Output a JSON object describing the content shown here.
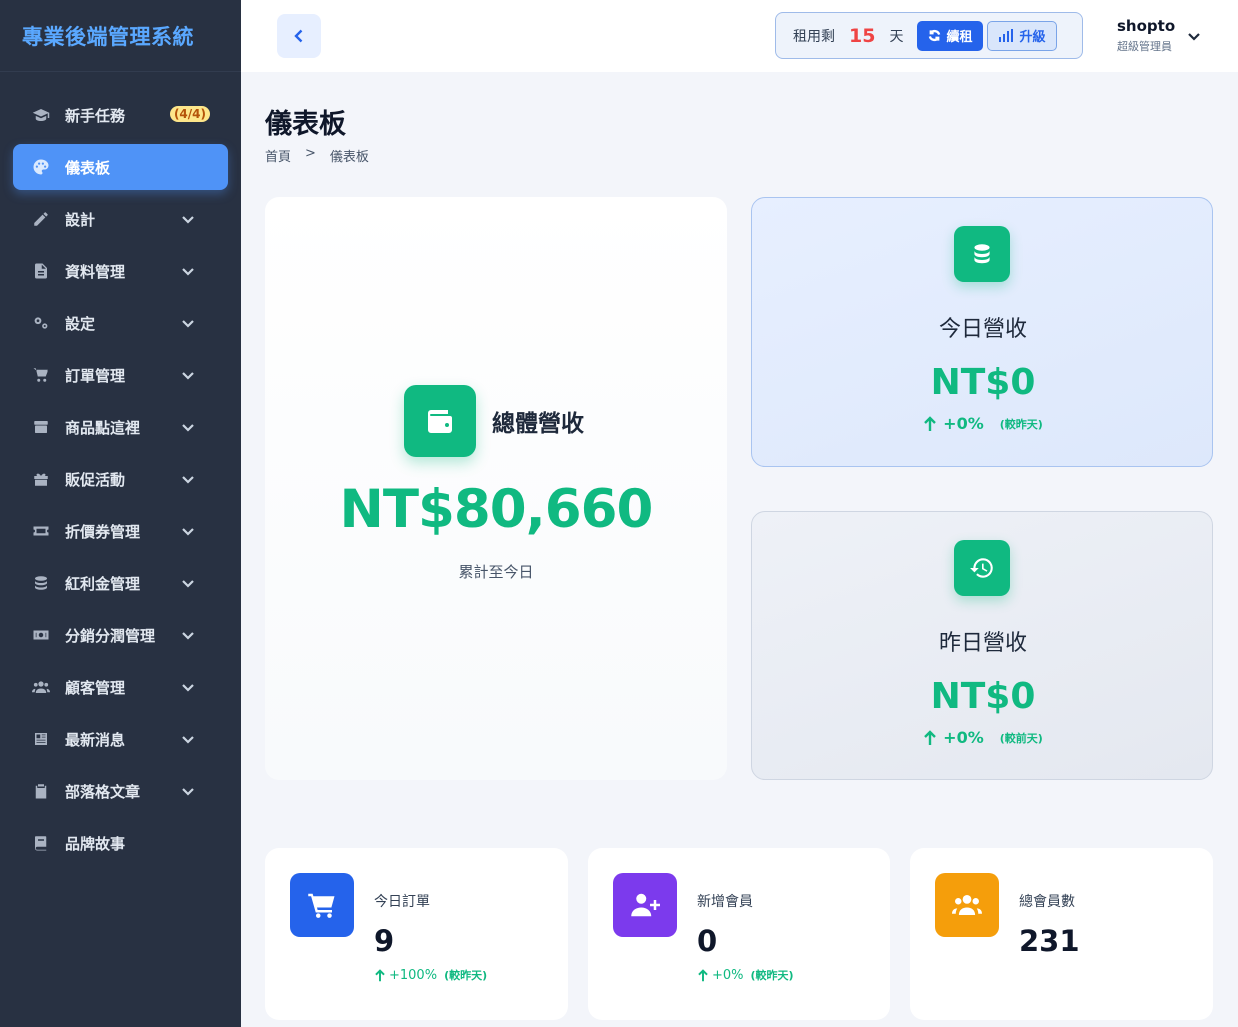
{
  "sidebar": {
    "brand": "專業後端管理系統",
    "items": [
      {
        "label": "新手任務",
        "badge": "(4/4)",
        "icon": "graduation-cap-icon"
      },
      {
        "label": "儀表板",
        "icon": "palette-icon",
        "active": true
      },
      {
        "label": "設計",
        "icon": "pencil-icon"
      },
      {
        "label": "資料管理",
        "icon": "file-icon"
      },
      {
        "label": "設定",
        "icon": "gears-icon"
      },
      {
        "label": "訂單管理",
        "icon": "cart-icon"
      },
      {
        "label": "商品點這裡",
        "icon": "box-icon"
      },
      {
        "label": "販促活動",
        "icon": "gift-icon"
      },
      {
        "label": "折價券管理",
        "icon": "ticket-icon"
      },
      {
        "label": "紅利金管理",
        "icon": "coins-icon"
      },
      {
        "label": "分銷分潤管理",
        "icon": "money-icon"
      },
      {
        "label": "顧客管理",
        "icon": "users-icon"
      },
      {
        "label": "最新消息",
        "icon": "newspaper-icon"
      },
      {
        "label": "部落格文章",
        "icon": "clipboard-icon"
      },
      {
        "label": "品牌故事",
        "icon": "book-icon"
      }
    ]
  },
  "topbar": {
    "rent_label": "租用剩",
    "rent_days": "15",
    "rent_unit": "天",
    "renew_label": "續租",
    "upgrade_label": "升級",
    "user_name": "shopto",
    "user_role": "超級管理員"
  },
  "page": {
    "title": "儀表板",
    "breadcrumb": [
      "首頁",
      ">",
      "儀表板"
    ]
  },
  "revenue": {
    "total_label": "總體營收",
    "total_value": "NT$80,660",
    "total_sub": "累計至今日",
    "today_label": "今日營收",
    "today_value": "NT$0",
    "today_change": "+0%",
    "today_compare": "(較昨天)",
    "yesterday_label": "昨日營收",
    "yesterday_value": "NT$0",
    "yesterday_change": "+0%",
    "yesterday_compare": "(較前天)"
  },
  "stats": [
    {
      "label": "今日訂單",
      "value": "9",
      "change": "+100%",
      "compare": "(較昨天)",
      "color": "#2563eb",
      "icon": "cart-icon"
    },
    {
      "label": "新增會員",
      "value": "0",
      "change": "+0%",
      "compare": "(較昨天)",
      "color": "#7c3aed",
      "icon": "user-plus-icon"
    },
    {
      "label": "總會員數",
      "value": "231",
      "color": "#f59e0b",
      "icon": "users-icon"
    }
  ],
  "colors": {
    "accent": "#2563eb",
    "success": "#10b981",
    "sidebar_bg": "#283142",
    "active_item": "#4f93f7"
  }
}
